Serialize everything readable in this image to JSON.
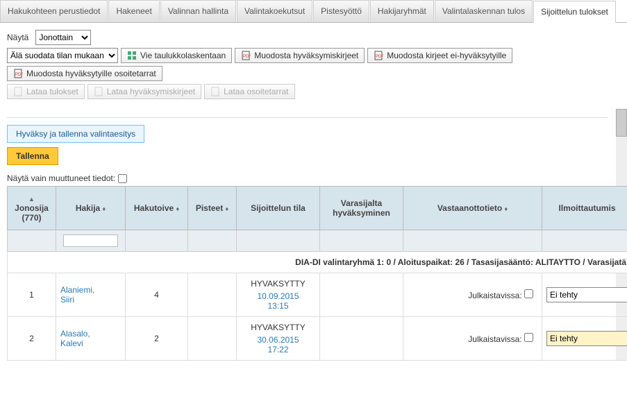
{
  "tabs": {
    "t0": "Hakukohteen perustiedot",
    "t1": "Hakeneet",
    "t2": "Valinnan hallinta",
    "t3": "Valintakoekutsut",
    "t4": "Pistesyöttö",
    "t5": "Hakijaryhmät",
    "t6": "Valintalaskennan tulos",
    "t7": "Sijoittelun tulokset"
  },
  "controls": {
    "nayta_label": "Näytä",
    "nayta_value": "Jonottain",
    "filter_value": "Älä suodata tilan mukaan",
    "vie": "Vie taulukkolaskentaan",
    "muod_hyv": "Muodosta hyväksymiskirjeet",
    "muod_ei": "Muodosta kirjeet ei-hyväksytyille",
    "muod_osoite": "Muodosta hyväksytyille osoitetarrat",
    "lataa_tul": "Lataa tulokset",
    "lataa_hyv": "Lataa hyväksymiskirjeet",
    "lataa_osoite": "Lataa osoitetarrat"
  },
  "actions": {
    "hyvaksy": "Hyväksy ja tallenna valintaesitys",
    "tallenna": "Tallenna",
    "muuttuneet": "Näytä vain muuttuneet tiedot:"
  },
  "headers": {
    "jonosija": "Jonosija (770)",
    "hakija": "Hakija",
    "hakutoive": "Hakutoive",
    "pisteet": "Pisteet",
    "sijoittelun": "Sijoittelun tila",
    "varasijalta": "Varasijalta hyväksyminen",
    "vastaanotto": "Vastaanottotieto",
    "ilmoittautumis": "Ilmoittautumis"
  },
  "group_row": "DIA-DI valintaryhmä 1: 0 / Aloituspaikat: 26 / Tasasijasääntö: ALITAYTTO / Varasijatä",
  "rows": [
    {
      "jono": "1",
      "hakija_fn": "Alaniemi,",
      "hakija_ln": "Siiri",
      "toive": "4",
      "status": "HYVAKSYTTY",
      "date": "10.09.2015",
      "time": "13:15",
      "julk": "Julkaistavissa:",
      "ilmo": "Ei tehty",
      "hl": false
    },
    {
      "jono": "2",
      "hakija_fn": "Alasalo,",
      "hakija_ln": "Kalevi",
      "toive": "2",
      "status": "HYVAKSYTTY",
      "date": "30.06.2015",
      "time": "17:22",
      "julk": "Julkaistavissa:",
      "ilmo": "Ei tehty",
      "hl": true
    }
  ]
}
